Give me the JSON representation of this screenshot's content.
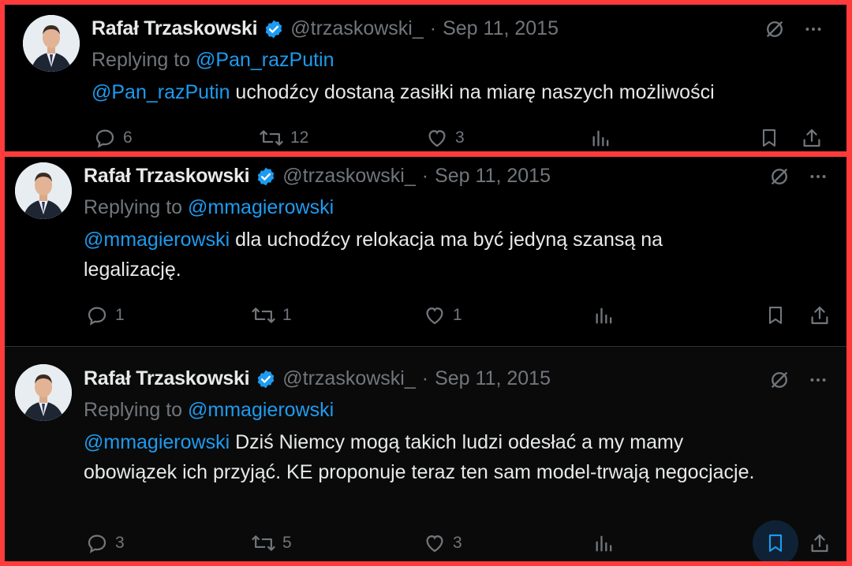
{
  "tweets": [
    {
      "author": "Rafał Trzaskowski",
      "handle": "@trzaskowski_",
      "separator": "·",
      "date": "Sep 11, 2015",
      "replying_prefix": "Replying to",
      "replying_to": "@Pan_razPutin",
      "mention": "@Pan_razPutin",
      "text": " uchodźcy dostaną zasiłki na miarę naszych możliwości",
      "replies": "6",
      "retweets": "12",
      "likes": "3"
    },
    {
      "author": "Rafał Trzaskowski",
      "handle": "@trzaskowski_",
      "separator": "·",
      "date": "Sep 11, 2015",
      "replying_prefix": "Replying to",
      "replying_to": "@mmagierowski",
      "mention": "@mmagierowski",
      "text": " dla uchodźcy relokacja ma być jedyną szansą na legalizację.",
      "replies": "1",
      "retweets": "1",
      "likes": "1"
    },
    {
      "author": "Rafał Trzaskowski",
      "handle": "@trzaskowski_",
      "separator": "·",
      "date": "Sep 11, 2015",
      "replying_prefix": "Replying to",
      "replying_to": "@mmagierowski",
      "mention": "@mmagierowski",
      "text": " Dziś Niemcy mogą takich ludzi odesłać a my mamy obowiązek ich przyjąć.  KE proponuje teraz ten sam model-trwają negocjacje.",
      "replies": "3",
      "retweets": "5",
      "likes": "3"
    }
  ],
  "colors": {
    "frame": "#ff3b3b",
    "background": "#000000",
    "text": "#e7e9ea",
    "muted": "#71767b",
    "accent": "#1d9bf0"
  },
  "icons": [
    "verified-badge-icon",
    "grok-icon",
    "more-icon",
    "reply-icon",
    "retweet-icon",
    "like-icon",
    "views-icon",
    "bookmark-icon",
    "share-icon"
  ]
}
